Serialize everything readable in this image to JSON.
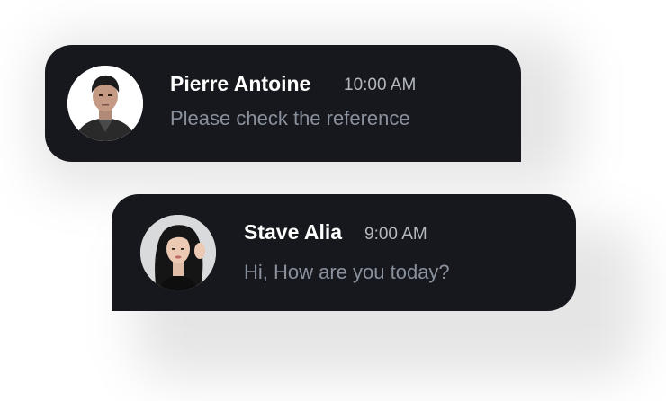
{
  "messages": [
    {
      "sender": "Pierre Antoine",
      "time": "10:00 AM",
      "text": "Please check the reference",
      "avatar_icon": "avatar-man-photo"
    },
    {
      "sender": "Stave Alia",
      "time": "9:00 AM",
      "text": "Hi, How are you today?",
      "avatar_icon": "avatar-woman-photo"
    }
  ],
  "colors": {
    "card_bg": "#16181d",
    "name": "#ffffff",
    "time": "#b3b7bf",
    "message": "#8a909c"
  }
}
